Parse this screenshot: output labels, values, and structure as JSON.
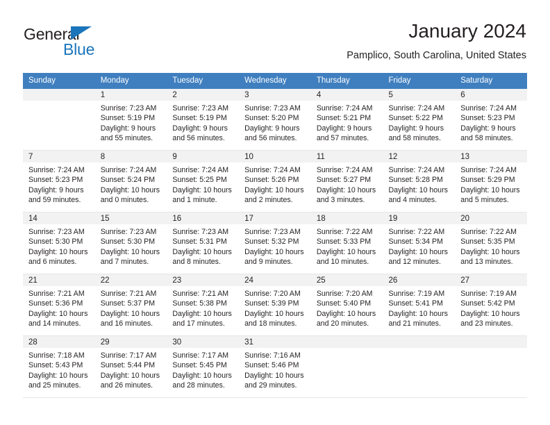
{
  "brand": {
    "name_top": "General",
    "name_bottom": "Blue",
    "triangle_color": "#1b75bb",
    "text_color": "#231f20"
  },
  "header": {
    "title": "January 2024",
    "subtitle": "Pamplico, South Carolina, United States"
  },
  "theme": {
    "header_row_bg": "#3f7fbf",
    "header_row_text": "#ffffff",
    "daynum_bg": "#f2f2f2",
    "cell_border": "#e6e6e6",
    "body_text": "#231f20"
  },
  "weekday_headers": [
    "Sunday",
    "Monday",
    "Tuesday",
    "Wednesday",
    "Thursday",
    "Friday",
    "Saturday"
  ],
  "weeks": [
    [
      {
        "day": "",
        "lines": [
          "",
          "",
          "",
          ""
        ]
      },
      {
        "day": "1",
        "lines": [
          "Sunrise: 7:23 AM",
          "Sunset: 5:19 PM",
          "Daylight: 9 hours",
          "and 55 minutes."
        ]
      },
      {
        "day": "2",
        "lines": [
          "Sunrise: 7:23 AM",
          "Sunset: 5:19 PM",
          "Daylight: 9 hours",
          "and 56 minutes."
        ]
      },
      {
        "day": "3",
        "lines": [
          "Sunrise: 7:23 AM",
          "Sunset: 5:20 PM",
          "Daylight: 9 hours",
          "and 56 minutes."
        ]
      },
      {
        "day": "4",
        "lines": [
          "Sunrise: 7:24 AM",
          "Sunset: 5:21 PM",
          "Daylight: 9 hours",
          "and 57 minutes."
        ]
      },
      {
        "day": "5",
        "lines": [
          "Sunrise: 7:24 AM",
          "Sunset: 5:22 PM",
          "Daylight: 9 hours",
          "and 58 minutes."
        ]
      },
      {
        "day": "6",
        "lines": [
          "Sunrise: 7:24 AM",
          "Sunset: 5:23 PM",
          "Daylight: 9 hours",
          "and 58 minutes."
        ]
      }
    ],
    [
      {
        "day": "7",
        "lines": [
          "Sunrise: 7:24 AM",
          "Sunset: 5:23 PM",
          "Daylight: 9 hours",
          "and 59 minutes."
        ]
      },
      {
        "day": "8",
        "lines": [
          "Sunrise: 7:24 AM",
          "Sunset: 5:24 PM",
          "Daylight: 10 hours",
          "and 0 minutes."
        ]
      },
      {
        "day": "9",
        "lines": [
          "Sunrise: 7:24 AM",
          "Sunset: 5:25 PM",
          "Daylight: 10 hours",
          "and 1 minute."
        ]
      },
      {
        "day": "10",
        "lines": [
          "Sunrise: 7:24 AM",
          "Sunset: 5:26 PM",
          "Daylight: 10 hours",
          "and 2 minutes."
        ]
      },
      {
        "day": "11",
        "lines": [
          "Sunrise: 7:24 AM",
          "Sunset: 5:27 PM",
          "Daylight: 10 hours",
          "and 3 minutes."
        ]
      },
      {
        "day": "12",
        "lines": [
          "Sunrise: 7:24 AM",
          "Sunset: 5:28 PM",
          "Daylight: 10 hours",
          "and 4 minutes."
        ]
      },
      {
        "day": "13",
        "lines": [
          "Sunrise: 7:24 AM",
          "Sunset: 5:29 PM",
          "Daylight: 10 hours",
          "and 5 minutes."
        ]
      }
    ],
    [
      {
        "day": "14",
        "lines": [
          "Sunrise: 7:23 AM",
          "Sunset: 5:30 PM",
          "Daylight: 10 hours",
          "and 6 minutes."
        ]
      },
      {
        "day": "15",
        "lines": [
          "Sunrise: 7:23 AM",
          "Sunset: 5:30 PM",
          "Daylight: 10 hours",
          "and 7 minutes."
        ]
      },
      {
        "day": "16",
        "lines": [
          "Sunrise: 7:23 AM",
          "Sunset: 5:31 PM",
          "Daylight: 10 hours",
          "and 8 minutes."
        ]
      },
      {
        "day": "17",
        "lines": [
          "Sunrise: 7:23 AM",
          "Sunset: 5:32 PM",
          "Daylight: 10 hours",
          "and 9 minutes."
        ]
      },
      {
        "day": "18",
        "lines": [
          "Sunrise: 7:22 AM",
          "Sunset: 5:33 PM",
          "Daylight: 10 hours",
          "and 10 minutes."
        ]
      },
      {
        "day": "19",
        "lines": [
          "Sunrise: 7:22 AM",
          "Sunset: 5:34 PM",
          "Daylight: 10 hours",
          "and 12 minutes."
        ]
      },
      {
        "day": "20",
        "lines": [
          "Sunrise: 7:22 AM",
          "Sunset: 5:35 PM",
          "Daylight: 10 hours",
          "and 13 minutes."
        ]
      }
    ],
    [
      {
        "day": "21",
        "lines": [
          "Sunrise: 7:21 AM",
          "Sunset: 5:36 PM",
          "Daylight: 10 hours",
          "and 14 minutes."
        ]
      },
      {
        "day": "22",
        "lines": [
          "Sunrise: 7:21 AM",
          "Sunset: 5:37 PM",
          "Daylight: 10 hours",
          "and 16 minutes."
        ]
      },
      {
        "day": "23",
        "lines": [
          "Sunrise: 7:21 AM",
          "Sunset: 5:38 PM",
          "Daylight: 10 hours",
          "and 17 minutes."
        ]
      },
      {
        "day": "24",
        "lines": [
          "Sunrise: 7:20 AM",
          "Sunset: 5:39 PM",
          "Daylight: 10 hours",
          "and 18 minutes."
        ]
      },
      {
        "day": "25",
        "lines": [
          "Sunrise: 7:20 AM",
          "Sunset: 5:40 PM",
          "Daylight: 10 hours",
          "and 20 minutes."
        ]
      },
      {
        "day": "26",
        "lines": [
          "Sunrise: 7:19 AM",
          "Sunset: 5:41 PM",
          "Daylight: 10 hours",
          "and 21 minutes."
        ]
      },
      {
        "day": "27",
        "lines": [
          "Sunrise: 7:19 AM",
          "Sunset: 5:42 PM",
          "Daylight: 10 hours",
          "and 23 minutes."
        ]
      }
    ],
    [
      {
        "day": "28",
        "lines": [
          "Sunrise: 7:18 AM",
          "Sunset: 5:43 PM",
          "Daylight: 10 hours",
          "and 25 minutes."
        ]
      },
      {
        "day": "29",
        "lines": [
          "Sunrise: 7:17 AM",
          "Sunset: 5:44 PM",
          "Daylight: 10 hours",
          "and 26 minutes."
        ]
      },
      {
        "day": "30",
        "lines": [
          "Sunrise: 7:17 AM",
          "Sunset: 5:45 PM",
          "Daylight: 10 hours",
          "and 28 minutes."
        ]
      },
      {
        "day": "31",
        "lines": [
          "Sunrise: 7:16 AM",
          "Sunset: 5:46 PM",
          "Daylight: 10 hours",
          "and 29 minutes."
        ]
      },
      {
        "day": "",
        "lines": [
          "",
          "",
          "",
          ""
        ]
      },
      {
        "day": "",
        "lines": [
          "",
          "",
          "",
          ""
        ]
      },
      {
        "day": "",
        "lines": [
          "",
          "",
          "",
          ""
        ]
      }
    ]
  ]
}
